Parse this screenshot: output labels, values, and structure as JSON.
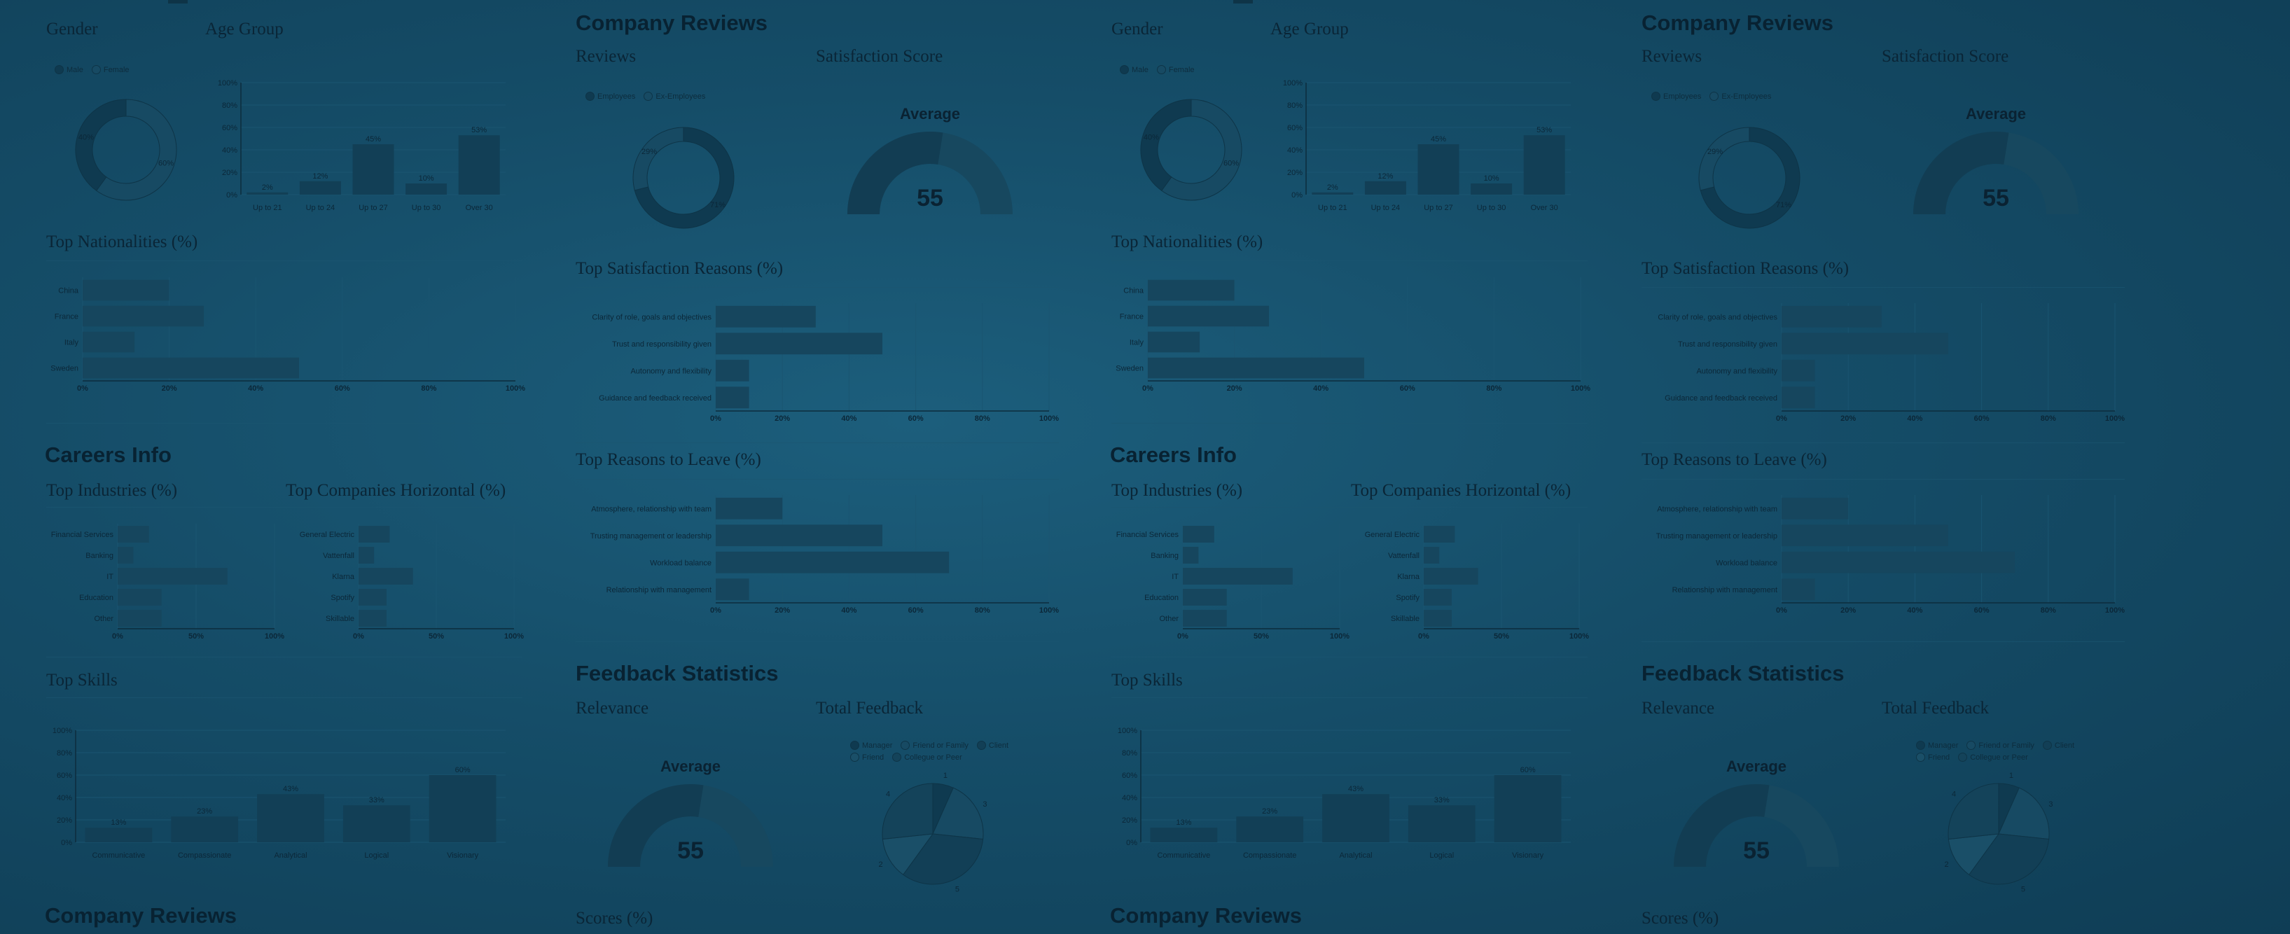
{
  "colors": {
    "background": "#154d68",
    "bar": "#123f56",
    "text": "#0b2535",
    "donut_dark": "#0f3a50",
    "donut_light": "#174a63"
  },
  "demographics": {
    "gender_title": "Gender",
    "age_title": "Age Group",
    "gender_legend": [
      "Male",
      "Female"
    ]
  },
  "company_reviews": {
    "title": "Company Reviews",
    "reviews_title": "Reviews",
    "satisfaction_title": "Satisfaction Score",
    "reviews_legend": [
      "Employees",
      "Ex-Employees"
    ],
    "gauge_label": "Average"
  },
  "nationalities": {
    "title": "Top Nationalities (%)"
  },
  "satisfaction_reasons": {
    "title": "Top Satisfaction Reasons (%)"
  },
  "careers": {
    "title": "Careers Info",
    "industries_title": "Top Industries (%)",
    "companies_title": "Top Companies Horizontal (%)"
  },
  "leave_reasons": {
    "title": "Top Reasons to Leave (%)"
  },
  "skills": {
    "title": "Top Skills"
  },
  "feedback": {
    "title": "Feedback Statistics",
    "relevance_title": "Relevance",
    "total_title": "Total Feedback",
    "gauge_label": "Average",
    "legend": [
      "Manager",
      "Friend or Family",
      "Client",
      "Friend",
      "Collegue or Peer"
    ]
  },
  "scores": {
    "title": "Scores (%)"
  },
  "bottom": {
    "title": "Company Reviews"
  },
  "chart_data": [
    {
      "id": "gender",
      "type": "pie",
      "labels": [
        "Male",
        "Female"
      ],
      "values": [
        60,
        40
      ],
      "label_text": [
        "60%",
        "40%"
      ]
    },
    {
      "id": "age",
      "type": "bar",
      "categories": [
        "Up to 21",
        "Up to 24",
        "Up to 27",
        "Up to 30",
        "Over 30"
      ],
      "values": [
        2,
        12,
        45,
        10,
        53
      ],
      "yticks": [
        "0%",
        "20%",
        "40%",
        "60%",
        "80%",
        "100%"
      ],
      "ylim": [
        0,
        100
      ]
    },
    {
      "id": "reviews",
      "type": "pie",
      "labels": [
        "Employees",
        "Ex-Employees"
      ],
      "values": [
        71,
        29
      ],
      "label_text": [
        "71%",
        "29%"
      ]
    },
    {
      "id": "satisfaction_gauge",
      "type": "gauge",
      "value": 55,
      "range": [
        0,
        100
      ]
    },
    {
      "id": "nationalities",
      "type": "bar",
      "orientation": "horizontal",
      "categories": [
        "China",
        "France",
        "Italy",
        "Sweden"
      ],
      "values": [
        20,
        28,
        12,
        50
      ],
      "xticks": [
        "0%",
        "20%",
        "40%",
        "60%",
        "80%",
        "100%"
      ],
      "xlim": [
        0,
        100
      ]
    },
    {
      "id": "satisfaction_reasons",
      "type": "bar",
      "orientation": "horizontal",
      "categories": [
        "Clarity of role, goals and objectives",
        "Trust and responsibility given",
        "Autonomy and flexibility",
        "Guidance and feedback received"
      ],
      "values": [
        30,
        50,
        10,
        10
      ],
      "xticks": [
        "0%",
        "20%",
        "40%",
        "60%",
        "80%",
        "100%"
      ],
      "xlim": [
        0,
        100
      ]
    },
    {
      "id": "industries",
      "type": "bar",
      "orientation": "horizontal",
      "categories": [
        "Financial Services",
        "Banking",
        "IT",
        "Education",
        "Other"
      ],
      "values": [
        20,
        10,
        70,
        28,
        28
      ],
      "xticks": [
        "0%",
        "50%",
        "100%"
      ],
      "xlim": [
        0,
        100
      ]
    },
    {
      "id": "companies",
      "type": "bar",
      "orientation": "horizontal",
      "categories": [
        "General Electric",
        "Vattenfall",
        "Klarna",
        "Spotify",
        "Skillable"
      ],
      "values": [
        20,
        10,
        35,
        18,
        18
      ],
      "xticks": [
        "0%",
        "50%",
        "100%"
      ],
      "xlim": [
        0,
        100
      ]
    },
    {
      "id": "leave_reasons",
      "type": "bar",
      "orientation": "horizontal",
      "categories": [
        "Atmosphere, relationship with team",
        "Trusting management or leadership",
        "Workload balance",
        "Relationship with management"
      ],
      "values": [
        20,
        50,
        70,
        10
      ],
      "xticks": [
        "0%",
        "20%",
        "40%",
        "60%",
        "80%",
        "100%"
      ],
      "xlim": [
        0,
        100
      ]
    },
    {
      "id": "skills",
      "type": "bar",
      "categories": [
        "Communicative",
        "Compassionate",
        "Analytical",
        "Logical",
        "Visionary"
      ],
      "values": [
        13,
        23,
        43,
        33,
        60
      ],
      "yticks": [
        "0%",
        "20%",
        "40%",
        "60%",
        "80%",
        "100%"
      ],
      "ylim": [
        0,
        100
      ]
    },
    {
      "id": "relevance_gauge",
      "type": "gauge",
      "value": 55,
      "range": [
        0,
        100
      ]
    },
    {
      "id": "total_feedback",
      "type": "pie",
      "labels": [
        "Manager",
        "Friend or Family",
        "Client",
        "Friend",
        "Collegue or Peer"
      ],
      "values": [
        1,
        3,
        5,
        2,
        4
      ],
      "label_text": [
        "1",
        "3",
        "5",
        "2",
        "4"
      ]
    }
  ]
}
